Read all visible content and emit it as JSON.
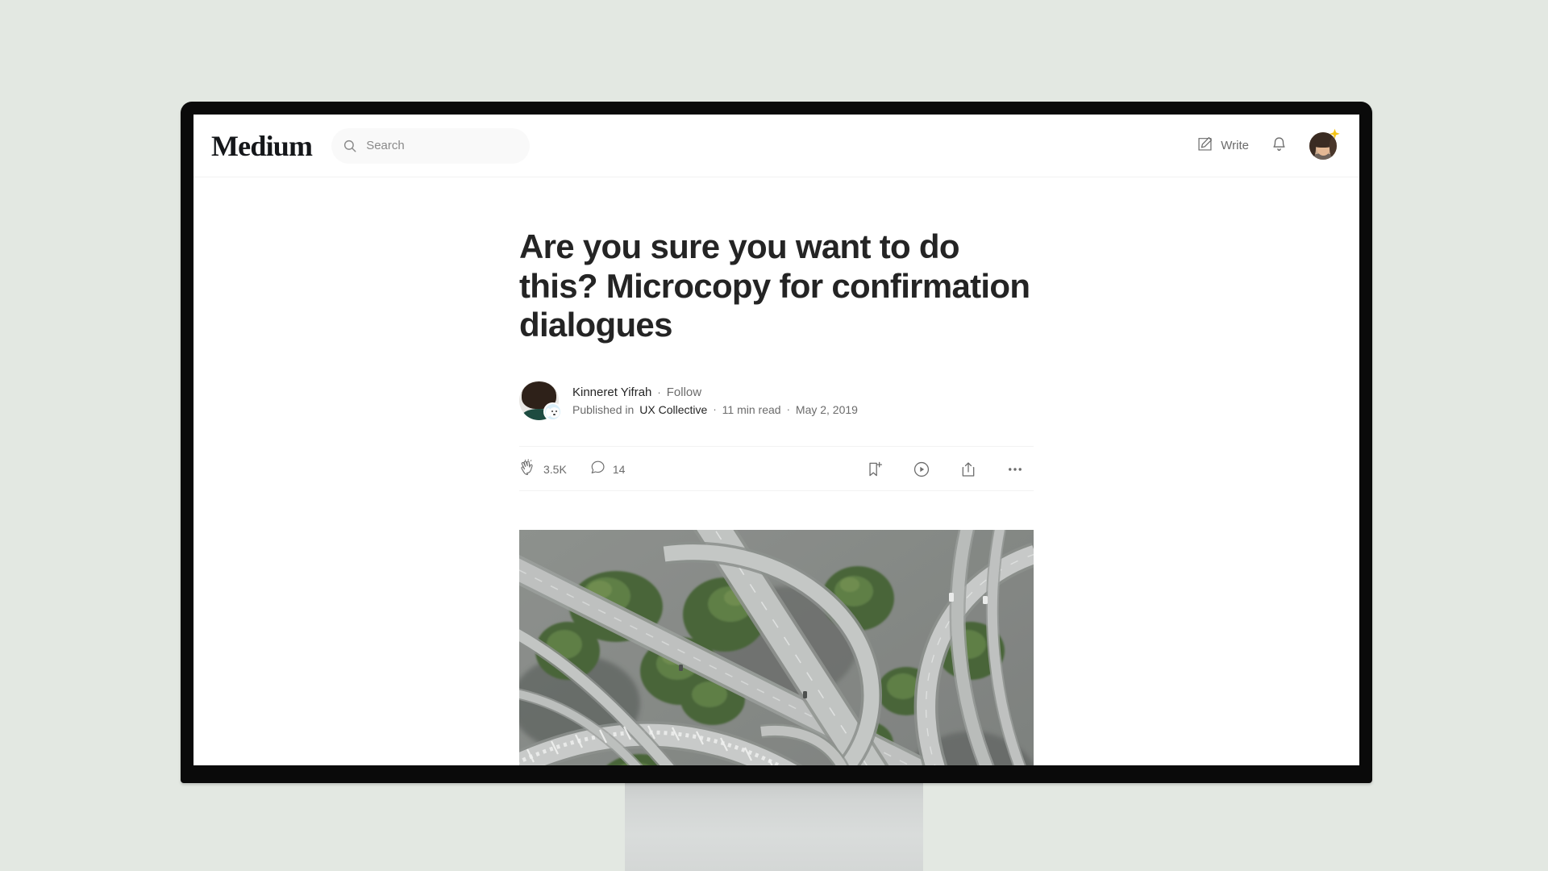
{
  "background_color": "#e3e8e2",
  "header": {
    "logo": "Medium",
    "search": {
      "placeholder": "Search",
      "value": "",
      "icon": "search-icon"
    },
    "write_label": "Write",
    "write_icon": "write-pencil-icon",
    "notifications_icon": "bell-icon",
    "avatar_icon": "user-avatar",
    "avatar_badge_icon": "sparkle-icon"
  },
  "article": {
    "title": "Are you sure you want to do this? Microcopy for confirmation dialogues",
    "byline": {
      "author_name": "Kinneret Yifrah",
      "separator": "·",
      "follow_label": "Follow",
      "published_in_label": "Published in",
      "publication": "UX Collective",
      "read_time": "11 min read",
      "date": "May 2, 2019",
      "avatar_icon": "author-avatar",
      "publication_badge_icon": "ux-collective-dog-icon"
    },
    "engagement": {
      "claps": "3.5K",
      "claps_icon": "clap-icon",
      "responses": "14",
      "responses_icon": "comment-icon",
      "actions": [
        {
          "name": "save-bookmark",
          "icon": "bookmark-add-icon"
        },
        {
          "name": "listen",
          "icon": "play-circle-icon"
        },
        {
          "name": "share",
          "icon": "share-icon"
        },
        {
          "name": "more-options",
          "icon": "ellipsis-icon"
        }
      ]
    },
    "hero_image": {
      "alt": "Aerial view of a multi-level highway interchange surrounded by green trees",
      "colors": {
        "road": "#b9bcba",
        "road_dark": "#8d918e",
        "foliage": "#4a6b37",
        "foliage_light": "#6f8f52",
        "ground": "#6e726f"
      }
    }
  },
  "colors": {
    "text_primary": "#242424",
    "text_secondary": "#6b6b6b",
    "bezel": "#0a0a0a",
    "screen": "#ffffff",
    "stand": "#d2d5d4",
    "sparkle": "#f5c518"
  }
}
